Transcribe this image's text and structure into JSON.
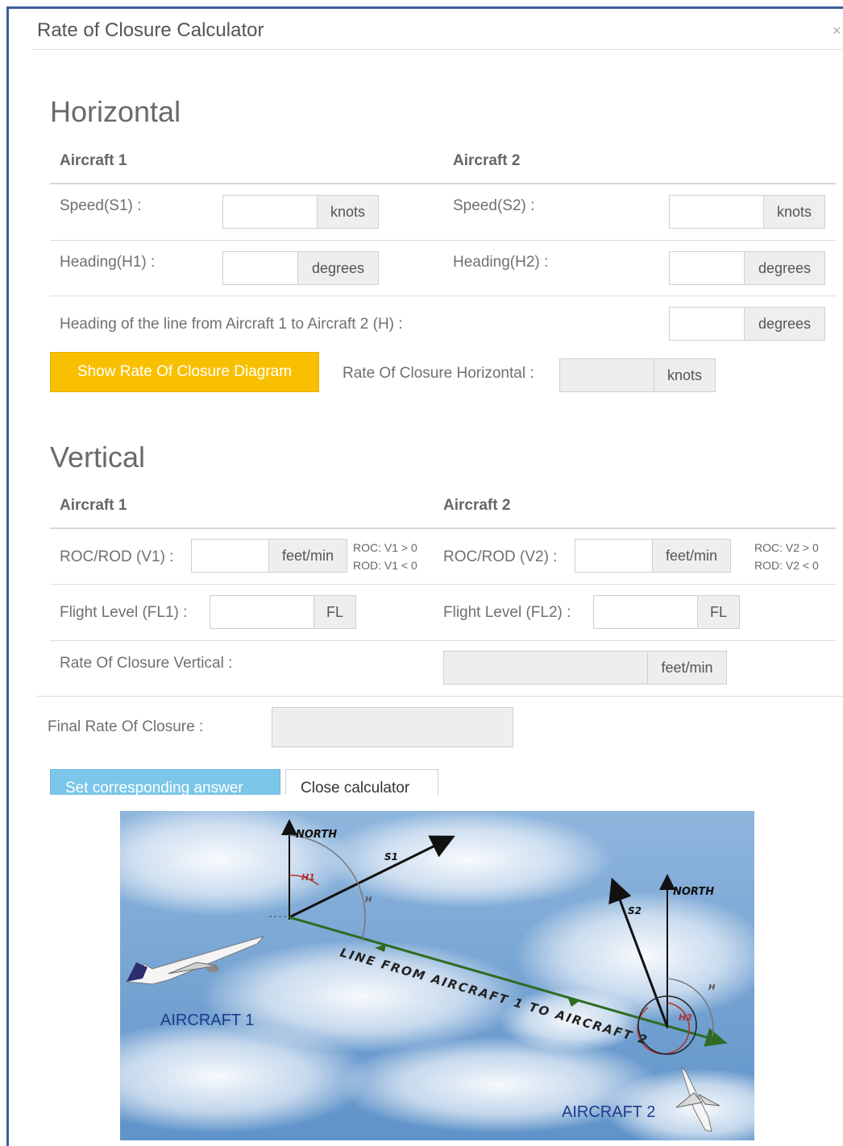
{
  "modal": {
    "title": "Rate of Closure Calculator",
    "close_glyph": "×"
  },
  "horizontal": {
    "heading": "Horizontal",
    "aircraft1_header": "Aircraft 1",
    "aircraft2_header": "Aircraft 2",
    "speed1_label": "Speed(S1) :",
    "speed2_label": "Speed(S2) :",
    "heading1_label": "Heading(H1) :",
    "heading2_label": "Heading(H2) :",
    "line_heading_label": "Heading of the line from Aircraft 1 to Aircraft 2 (H) :",
    "unit_knots": "knots",
    "unit_degrees": "degrees",
    "show_diagram_button": "Show Rate Of Closure Diagram",
    "result_label": "Rate Of Closure Horizontal :",
    "result_unit": "knots",
    "values": {
      "speed1": "",
      "speed2": "",
      "heading1": "",
      "heading2": "",
      "line_heading": "",
      "result": ""
    }
  },
  "vertical": {
    "heading": "Vertical",
    "aircraft1_header": "Aircraft 1",
    "aircraft2_header": "Aircraft 2",
    "rocrod1_label": "ROC/ROD (V1) :",
    "rocrod2_label": "ROC/ROD (V2) :",
    "unit_feetmin": "feet/min",
    "hint1_roc": "ROC: V1 > 0",
    "hint1_rod": "ROD: V1 < 0",
    "hint2_roc": "ROC: V2 > 0",
    "hint2_rod": "ROD: V2 < 0",
    "fl1_label": "Flight Level (FL1) :",
    "fl2_label": "Flight Level (FL2) :",
    "unit_fl": "FL",
    "result_label": "Rate Of Closure Vertical :",
    "result_unit": "feet/min",
    "values": {
      "v1": "",
      "v2": "",
      "fl1": "",
      "fl2": "",
      "result": ""
    }
  },
  "final": {
    "label": "Final Rate Of Closure :",
    "value": ""
  },
  "actions": {
    "set_answer": "Set corresponding answer",
    "close_calculator": "Close calculator"
  },
  "diagram": {
    "north1": "NORTH",
    "north2": "NORTH",
    "s1": "S1",
    "s2": "S2",
    "h1": "H1",
    "h2": "H2",
    "h_a": "H",
    "h_b": "H",
    "line_label": "LINE FROM AIRCRAFT 1 TO AIRCRAFT 2",
    "aircraft1": "AIRCRAFT  1",
    "aircraft2": "AIRCRAFT  2",
    "colors": {
      "sky": "#6e9fd0",
      "line": "#2f6b22",
      "label_blue": "#1f3a8a",
      "arc_red": "#b03030"
    }
  }
}
